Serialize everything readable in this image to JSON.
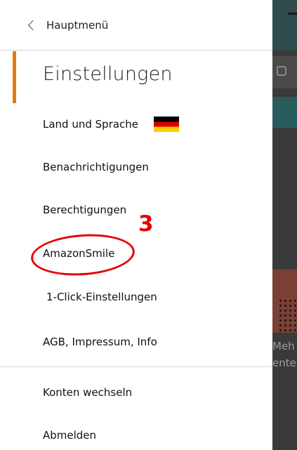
{
  "header": {
    "back_label": "Hauptmenü"
  },
  "section": {
    "title": "Einstellungen",
    "accent_color": "#e47911"
  },
  "menu": {
    "items": [
      {
        "label": "Land und Sprache",
        "icon": "german-flag-icon"
      },
      {
        "label": "Benachrichtigungen"
      },
      {
        "label": "Berechtigungen"
      },
      {
        "label": "AmazonSmile"
      },
      {
        "label": "1-Click-Einstellungen"
      },
      {
        "label": "AGB, Impressum, Info"
      }
    ],
    "account_items": [
      {
        "label": "Konten wechseln"
      },
      {
        "label": "Abmelden"
      }
    ]
  },
  "annotation": {
    "step_number": "3",
    "highlight_color": "#e60000",
    "highlighted_item": "AmazonSmile"
  },
  "background_app": {
    "text_line_1": "Meh",
    "text_line_2": "ente"
  }
}
